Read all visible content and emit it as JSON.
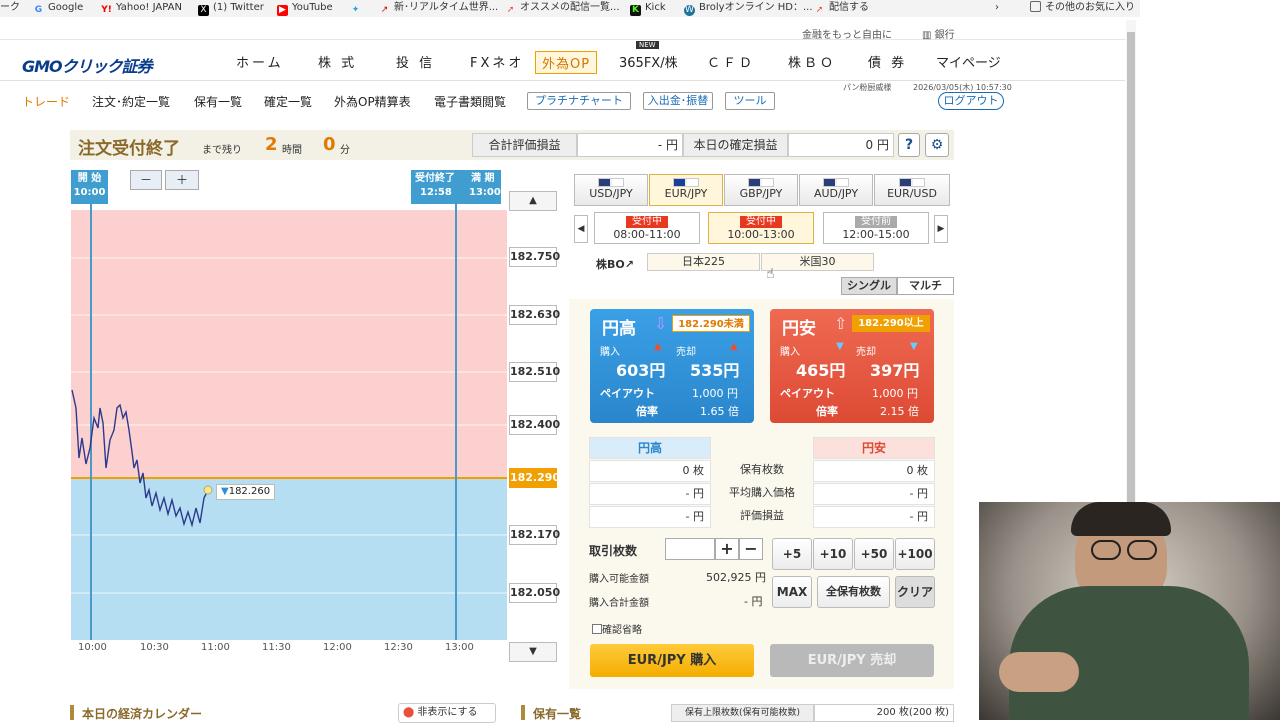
{
  "bookmarks": [
    "ーク",
    "Google",
    "Yahoo! JAPAN",
    "(1) Twitter",
    "YouTube",
    "",
    "新･リアルタイム世界...",
    "オススメの配信一覧...",
    "Kick",
    "Brolyオンライン HD：...",
    "配信する",
    "その他のお気に入り"
  ],
  "topbar": {
    "tagline": "金融をもっと自由に",
    "bank": "銀行"
  },
  "brand": "GMOクリック証券",
  "nav": [
    "ホーム",
    "株 式",
    "投 信",
    "FXネオ",
    "外為OP",
    "365FX/株",
    "ＣＦＤ",
    "株ＢＯ",
    "債 券",
    "マイページ"
  ],
  "nav_new": "NEW",
  "user": {
    "name": "パン粉厨威様",
    "datetime": "2026/03/05(木) 10:57:30",
    "logout": "ログアウト"
  },
  "subnav": [
    "トレード",
    "注文･約定一覧",
    "保有一覧",
    "確定一覧",
    "外為OP精算表",
    "電子書類閲覧"
  ],
  "subnav_buttons": [
    "プラチナチャート",
    "入出金･振替",
    "ツール"
  ],
  "status": {
    "title": "注文受付終了",
    "remain_label": "まで残り",
    "hours": "2",
    "hours_unit": "時間",
    "minutes": "0",
    "minutes_unit": "分",
    "pl_eval_label": "合計評価損益",
    "pl_eval_value": "- 円",
    "pl_today_label": "本日の確定損益",
    "pl_today_value": "0 円",
    "help": "?",
    "gear": "⚙"
  },
  "chart": {
    "start_label": "開 始",
    "start_time": "10:00",
    "close_label": "受付終了",
    "close_time": "12:58",
    "expiry_label": "満 期",
    "expiry_time": "13:00",
    "zoom_out": "－",
    "zoom_in": "＋",
    "y_ticks": [
      "182.750",
      "182.630",
      "182.510",
      "182.400",
      "182.290",
      "182.170",
      "182.050"
    ],
    "x_ticks": [
      "10:00",
      "10:30",
      "11:00",
      "11:30",
      "12:00",
      "12:30",
      "13:00"
    ],
    "strike": "182.290",
    "current": "182.260",
    "up": "▲",
    "down": "▼"
  },
  "chart_data": {
    "type": "line",
    "x_ticks": [
      "10:00",
      "10:30",
      "11:00",
      "11:30",
      "12:00",
      "12:30",
      "13:00"
    ],
    "y_ticks": [
      182.75,
      182.63,
      182.51,
      182.4,
      182.29,
      182.17,
      182.05
    ],
    "strike": 182.29,
    "current": 182.26
  },
  "pairs": [
    "USD/JPY",
    "EUR/JPY",
    "GBP/JPY",
    "AUD/JPY",
    "EUR/USD"
  ],
  "sessions": [
    {
      "tag": "受付中",
      "time": "08:00-11:00"
    },
    {
      "tag": "受付中",
      "time": "10:00-13:00"
    },
    {
      "tag": "受付前",
      "time": "12:00-15:00"
    }
  ],
  "kabu": {
    "label": "株BO↗",
    "items": [
      "日本225",
      "米国30"
    ]
  },
  "mode": [
    "シングル",
    "マルチ"
  ],
  "high": {
    "title": "円高",
    "target": "182.290未満",
    "buy_label": "購入",
    "sell_label": "売却",
    "buy": "603円",
    "sell": "535円",
    "payout_label": "ペイアウト",
    "payout": "1,000 円",
    "rate_label": "倍率",
    "rate": "1.65 倍"
  },
  "low": {
    "title": "円安",
    "target": "182.290以上",
    "buy_label": "購入",
    "sell_label": "売却",
    "buy": "465円",
    "sell": "397円",
    "payout_label": "ペイアウト",
    "payout": "1,000 円",
    "rate_label": "倍率",
    "rate": "2.15 倍"
  },
  "holdings": {
    "high": "円高",
    "low": "円安",
    "rows": [
      {
        "l": "0 枚",
        "m": "保有枚数",
        "r": "0 枚"
      },
      {
        "l": "- 円",
        "m": "平均購入価格",
        "r": "- 円"
      },
      {
        "l": "- 円",
        "m": "評価損益",
        "r": "- 円"
      }
    ]
  },
  "order": {
    "qty_label": "取引枚数",
    "plus": "+",
    "minus": "−",
    "add": [
      "+5",
      "+10",
      "+50",
      "+100"
    ],
    "avail_label": "購入可能金額",
    "avail": "502,925 円",
    "total_label": "購入合計金額",
    "total": "- 円",
    "max": "MAX",
    "all": "全保有枚数",
    "clear": "クリア",
    "skip": "確認省略",
    "buy_btn": "EUR/JPY 購入",
    "sell_btn": "EUR/JPY 売却"
  },
  "bottom": {
    "calendar": "本日の経済カレンダー",
    "hide": "非表示にする",
    "holdings": "保有一覧",
    "limit_label": "保有上限枚数(保有可能枚数)",
    "limit": "200 枚(200 枚)"
  },
  "colors": {
    "accent": "#f0a000",
    "high": "#2e8fd6",
    "low": "#e8503a"
  }
}
